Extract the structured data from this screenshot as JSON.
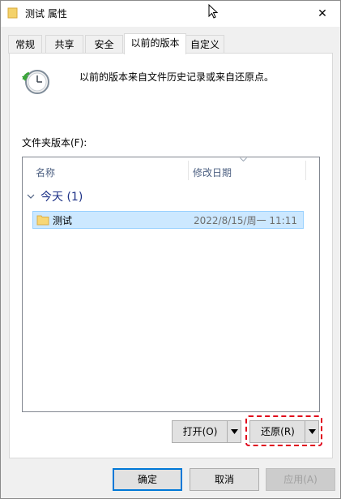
{
  "window": {
    "title": "测试 属性",
    "close_symbol": "✕"
  },
  "tabs": [
    {
      "label": "常规"
    },
    {
      "label": "共享"
    },
    {
      "label": "安全"
    },
    {
      "label": "以前的版本",
      "active": true
    },
    {
      "label": "自定义"
    }
  ],
  "panel": {
    "description": "以前的版本来自文件历史记录或来自还原点。",
    "folder_versions_label": "文件夹版本(F):",
    "icon": "history-clock-icon"
  },
  "list": {
    "columns": [
      "名称",
      "修改日期"
    ],
    "groups": [
      {
        "label": "今天 (1)",
        "items": [
          {
            "name": "测试",
            "modified": "2022/8/15/周一 11:11",
            "icon": "folder-icon",
            "selected": true
          }
        ]
      }
    ]
  },
  "buttons": {
    "open": "打开(O)",
    "restore": "还原(R)",
    "ok": "确定",
    "cancel": "取消",
    "apply": "应用(A)"
  },
  "colors": {
    "accent": "#0078d7",
    "selection": "#cce8ff",
    "highlight_dash": "#e0001a",
    "group_header": "#1e3287"
  }
}
